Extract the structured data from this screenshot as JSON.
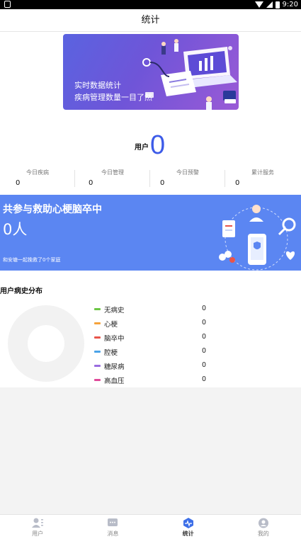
{
  "status_bar": {
    "time": "9:20"
  },
  "header": {
    "title": "统计"
  },
  "banner": {
    "line1": "实时数据统计",
    "line2": "疾病管理数量一目了然"
  },
  "user_count": {
    "label": "用户",
    "value": "0"
  },
  "stats": [
    {
      "label": "今日疾病",
      "value": "0"
    },
    {
      "label": "今日管理",
      "value": "0"
    },
    {
      "label": "今日预警",
      "value": "0"
    },
    {
      "label": "累计服务",
      "value": "0"
    }
  ],
  "rescue": {
    "title": "共参与救助心梗脑卒中",
    "count": "0人",
    "subtitle": "和安塘一起挽救了0个家庭"
  },
  "distribution": {
    "title": "用户病史分布",
    "items": [
      {
        "name": "无病史",
        "value": "0",
        "color": "#6cc644"
      },
      {
        "name": "心梗",
        "value": "0",
        "color": "#f5a33b"
      },
      {
        "name": "脑卒中",
        "value": "0",
        "color": "#e8544a"
      },
      {
        "name": "腔梗",
        "value": "0",
        "color": "#4aa3e8"
      },
      {
        "name": "糖尿病",
        "value": "0",
        "color": "#9a6ce0"
      },
      {
        "name": "高血压",
        "value": "0",
        "color": "#e04a9a"
      }
    ]
  },
  "tabs": [
    {
      "label": "用户",
      "icon": "user-icon"
    },
    {
      "label": "消息",
      "icon": "message-icon"
    },
    {
      "label": "统计",
      "icon": "stats-icon",
      "active": true
    },
    {
      "label": "我的",
      "icon": "profile-icon"
    }
  ]
}
